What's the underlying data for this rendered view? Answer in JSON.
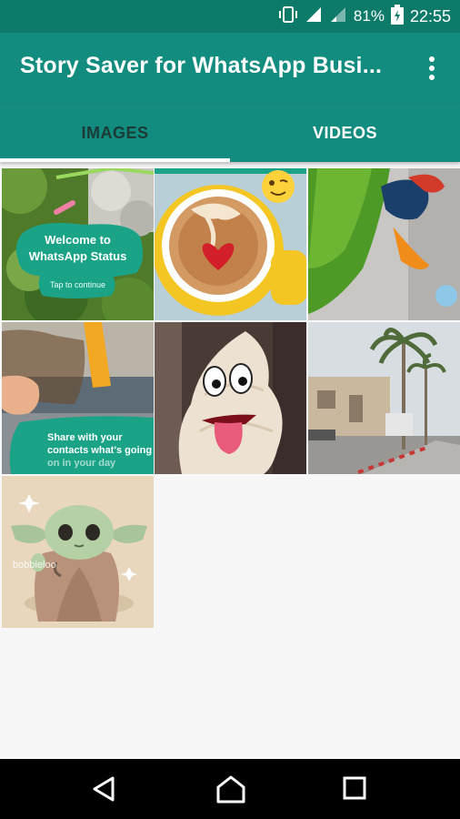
{
  "status_bar": {
    "battery": "81%",
    "time": "22:55",
    "icons": [
      "vibrate-icon",
      "signal-icon",
      "signal-icon",
      "battery-icon"
    ]
  },
  "app_bar": {
    "title": "Story Saver for WhatsApp Busi...",
    "menu_icon": "more-vert-icon"
  },
  "tabs": [
    {
      "label": "IMAGES",
      "selected": true
    },
    {
      "label": "VIDEOS",
      "selected": false
    }
  ],
  "grid": {
    "tile1": {
      "line1": "Welcome to",
      "line2": "WhatsApp Status",
      "line3": "Tap to continue"
    },
    "tile4": {
      "line1": "Share with your",
      "line2": "contacts what's going",
      "line3": "on in your day"
    },
    "tile7": {
      "watermark": "bobbieloo"
    }
  },
  "nav_bar": {
    "icons": [
      "back-icon",
      "home-icon",
      "recents-icon"
    ]
  },
  "colors": {
    "status_bar": "#0e7b6a",
    "app_bar": "#128c7e",
    "selected_tab_text": "#1c3b36",
    "unselected_tab_text": "#ffffff"
  }
}
